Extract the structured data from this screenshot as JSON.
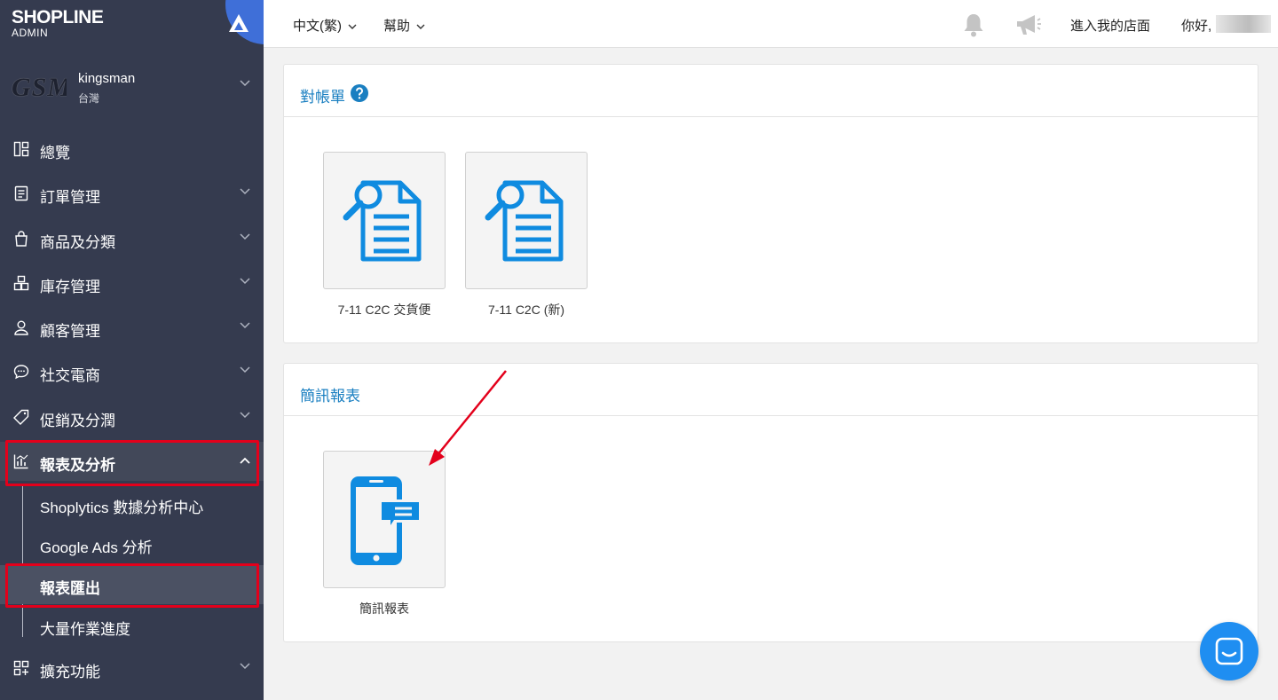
{
  "brand": {
    "name": "SHOPLINE",
    "sub": "ADMIN"
  },
  "store": {
    "logo_text": "GSM",
    "name": "kingsman",
    "region": "台灣"
  },
  "sidebar": {
    "items": [
      {
        "label": "總覽",
        "icon": "dashboard-icon"
      },
      {
        "label": "訂單管理",
        "icon": "order-icon"
      },
      {
        "label": "商品及分類",
        "icon": "bag-icon"
      },
      {
        "label": "庫存管理",
        "icon": "inventory-icon"
      },
      {
        "label": "顧客管理",
        "icon": "user-icon"
      },
      {
        "label": "社交電商",
        "icon": "chat-bubble-icon"
      },
      {
        "label": "促銷及分潤",
        "icon": "tag-icon"
      },
      {
        "label": "報表及分析",
        "icon": "chart-icon",
        "expanded": true
      },
      {
        "label": "擴充功能",
        "icon": "apps-icon"
      }
    ],
    "sub_items": [
      {
        "label": "Shoplytics 數據分析中心"
      },
      {
        "label": "Google Ads 分析"
      },
      {
        "label": "報表匯出",
        "active": true
      },
      {
        "label": "大量作業進度"
      }
    ]
  },
  "topbar": {
    "language": "中文(繁)",
    "help": "幫助",
    "enter_store": "進入我的店面",
    "greeting": "你好,"
  },
  "panels": [
    {
      "title": "對帳單",
      "tiles": [
        {
          "label": "7-11 C2C 交貨便",
          "icon": "document-search-icon"
        },
        {
          "label": "7-11 C2C (新)",
          "icon": "document-search-icon"
        }
      ]
    },
    {
      "title": "簡訊報表",
      "tiles": [
        {
          "label": "簡訊報表",
          "icon": "phone-message-icon"
        }
      ]
    }
  ],
  "colors": {
    "sidebar_bg": "#353b4f",
    "accent_blue": "#1a7fc1",
    "icon_blue": "#0f8be0",
    "highlight_red": "#e3001b",
    "chat_blue": "#1f8ef1"
  }
}
